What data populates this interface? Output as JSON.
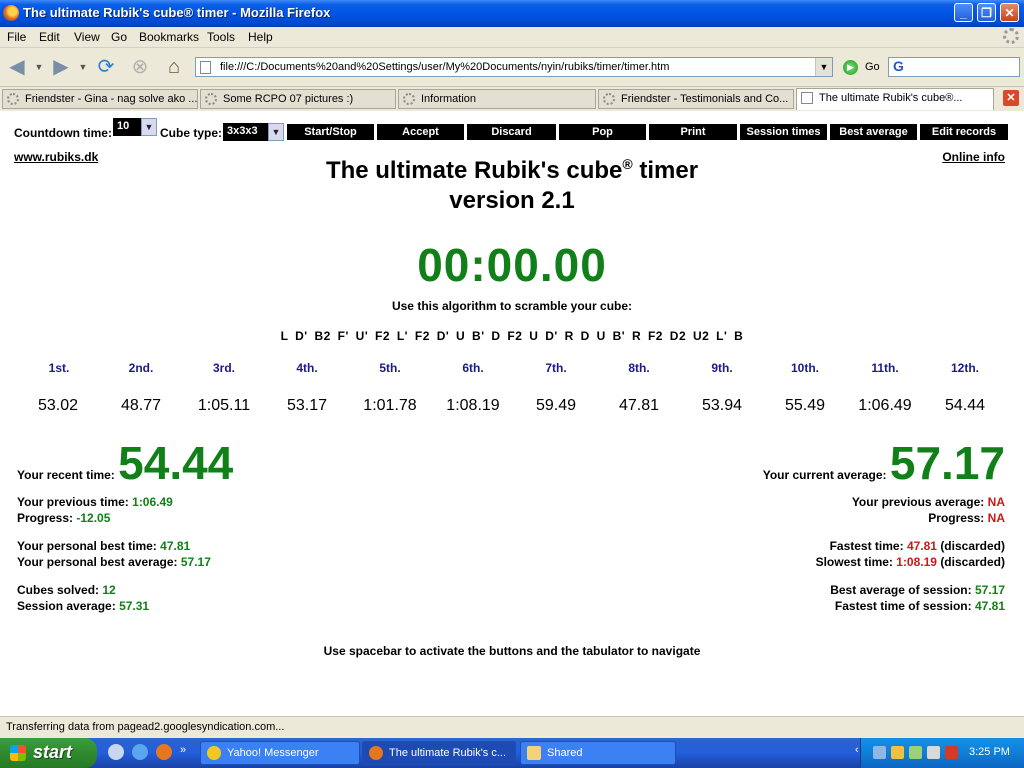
{
  "window": {
    "title": "The ultimate Rubik's cube® timer - Mozilla Firefox"
  },
  "menu": [
    "File",
    "Edit",
    "View",
    "Go",
    "Bookmarks",
    "Tools",
    "Help"
  ],
  "nav": {
    "url": "file:///C:/Documents%20and%20Settings/user/My%20Documents/nyin/rubiks/timer/timer.htm",
    "go_label": "Go"
  },
  "tabs": [
    {
      "label": "Friendster - Gina - nag solve ako ...",
      "active": false
    },
    {
      "label": "Some RCPO 07 pictures :)",
      "active": false
    },
    {
      "label": "Information",
      "active": false
    },
    {
      "label": "Friendster - Testimonials and Co...",
      "active": false
    },
    {
      "label": "The ultimate Rubik's cube®...",
      "active": true
    }
  ],
  "controls": {
    "countdown_label": "Countdown time:",
    "countdown_value": "10",
    "cube_type_label": "Cube type:",
    "cube_type_value": "3x3x3",
    "buttons": [
      "Start/Stop",
      "Accept",
      "Discard",
      "Pop",
      "Print",
      "Session times",
      "Best average",
      "Edit records"
    ]
  },
  "links": {
    "left": "www.rubiks.dk",
    "right": "Online info"
  },
  "heading": {
    "line1": "The ultimate Rubik's cube",
    "reg": "®",
    "line1_end": " timer",
    "line2": "version 2.1"
  },
  "timer": "00:00.00",
  "scramble": {
    "prompt": "Use this algorithm to scramble your cube:",
    "moves": "L D' B2 F' U' F2 L' F2 D' U B' D F2 U D' R D U B' R F2 D2 U2 L' B"
  },
  "times": {
    "ranks": [
      "1st.",
      "2nd.",
      "3rd.",
      "4th.",
      "5th.",
      "6th.",
      "7th.",
      "8th.",
      "9th.",
      "10th.",
      "11th.",
      "12th."
    ],
    "values": [
      "53.02",
      "48.77",
      "1:05.11",
      "53.17",
      "1:01.78",
      "1:08.19",
      "59.49",
      "47.81",
      "53.94",
      "55.49",
      "1:06.49",
      "54.44"
    ]
  },
  "left_stats": {
    "recent_label": "Your recent time:",
    "recent_value": "54.44",
    "previous_label": "Your previous time:",
    "previous_value": "1:06.49",
    "progress_label": "Progress:",
    "progress_value": "-12.05",
    "pb_time_label": "Your personal best time:",
    "pb_time_value": "47.81",
    "pb_avg_label": "Your personal best average:",
    "pb_avg_value": "57.17",
    "cubes_label": "Cubes solved:",
    "cubes_value": "12",
    "session_avg_label": "Session average:",
    "session_avg_value": "57.31"
  },
  "right_stats": {
    "current_avg_label": "Your current average:",
    "current_avg_value": "57.17",
    "prev_avg_label": "Your previous average:",
    "prev_avg_value": "NA",
    "progress_label": "Progress:",
    "progress_value": "NA",
    "fastest_label": "Fastest time:",
    "fastest_value": "47.81",
    "fastest_note": "(discarded)",
    "slowest_label": "Slowest time:",
    "slowest_value": "1:08.19",
    "slowest_note": "(discarded)",
    "best_session_avg_label": "Best average of session:",
    "best_session_avg_value": "57.17",
    "fastest_session_label": "Fastest time of session:",
    "fastest_session_value": "47.81"
  },
  "footer_hint": "Use spacebar to activate the buttons and the tabulator to navigate",
  "status": "Transferring data from pagead2.googlesyndication.com...",
  "taskbar": {
    "start": "start",
    "tasks": [
      {
        "label": "Yahoo! Messenger",
        "active": false
      },
      {
        "label": "The ultimate Rubik's c...",
        "active": true
      },
      {
        "label": "Shared",
        "active": false
      }
    ],
    "clock": "3:25 PM"
  },
  "colors": {
    "green": "#118018",
    "red": "#c81818",
    "rank_blue": "#1a1a8c"
  }
}
